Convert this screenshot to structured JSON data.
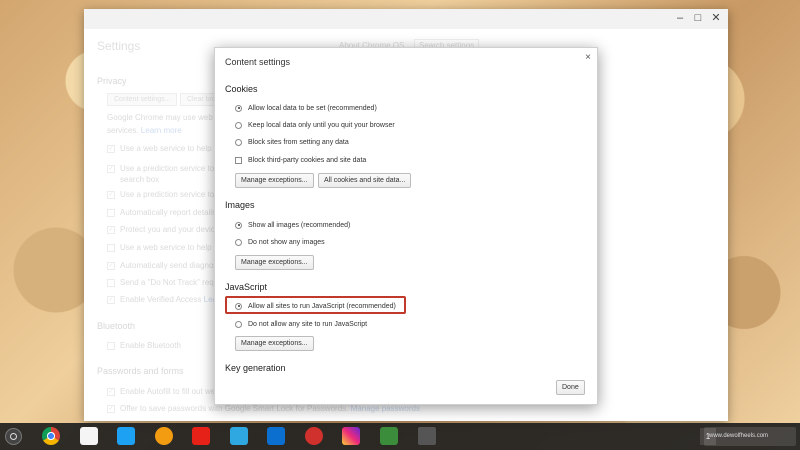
{
  "background_window": {
    "title": "Settings",
    "search_tab": "About Chrome OS",
    "search_placeholder": "Search settings",
    "privacy_heading": "Privacy",
    "content_settings_btn": "Content settings...",
    "clear_btn": "Clear bro",
    "privacy_desc1": "Google Chrome may use web serv",
    "privacy_desc2": "services.",
    "learn_more": "Learn more",
    "items": [
      "Use a web service to help reso",
      "Use a prediction service to hel",
      "search box",
      "Use a prediction service to loa",
      "Automatically report details o",
      "Protect you and your device fr",
      "Use a web service to help reso",
      "Automatically send diagnostic",
      "Send a \"Do Not Track\" request",
      "Enable Verified Access"
    ],
    "verified_link": "Learn",
    "bluetooth_heading": "Bluetooth",
    "bluetooth_item": "Enable Bluetooth",
    "passwords_heading": "Passwords and forms",
    "autofill_item": "Enable Autofill to fill out web f",
    "smartlock_item": "Offer to save passwords with Google Smart Lock for Passwords.",
    "manage_passwords": "Manage passwords"
  },
  "dialog": {
    "title": "Content settings",
    "close": "×",
    "cookies": {
      "heading": "Cookies",
      "options": [
        "Allow local data to be set (recommended)",
        "Keep local data only until you quit your browser",
        "Block sites from setting any data"
      ],
      "checkbox": "Block third-party cookies and site data",
      "btn_exceptions": "Manage exceptions...",
      "btn_all_cookies": "All cookies and site data..."
    },
    "images": {
      "heading": "Images",
      "options": [
        "Show all images (recommended)",
        "Do not show any images"
      ],
      "btn_exceptions": "Manage exceptions..."
    },
    "javascript": {
      "heading": "JavaScript",
      "options": [
        "Allow all sites to run JavaScript (recommended)",
        "Do not allow any site to run JavaScript"
      ],
      "btn_exceptions": "Manage exceptions..."
    },
    "keygen_heading": "Key generation",
    "done": "Done"
  },
  "shelf": {
    "tray_count": "1",
    "watermark": "www.dewolfheels.com"
  },
  "colors": {
    "highlight": "#c0392b",
    "shelf": "#1e1e1e"
  }
}
